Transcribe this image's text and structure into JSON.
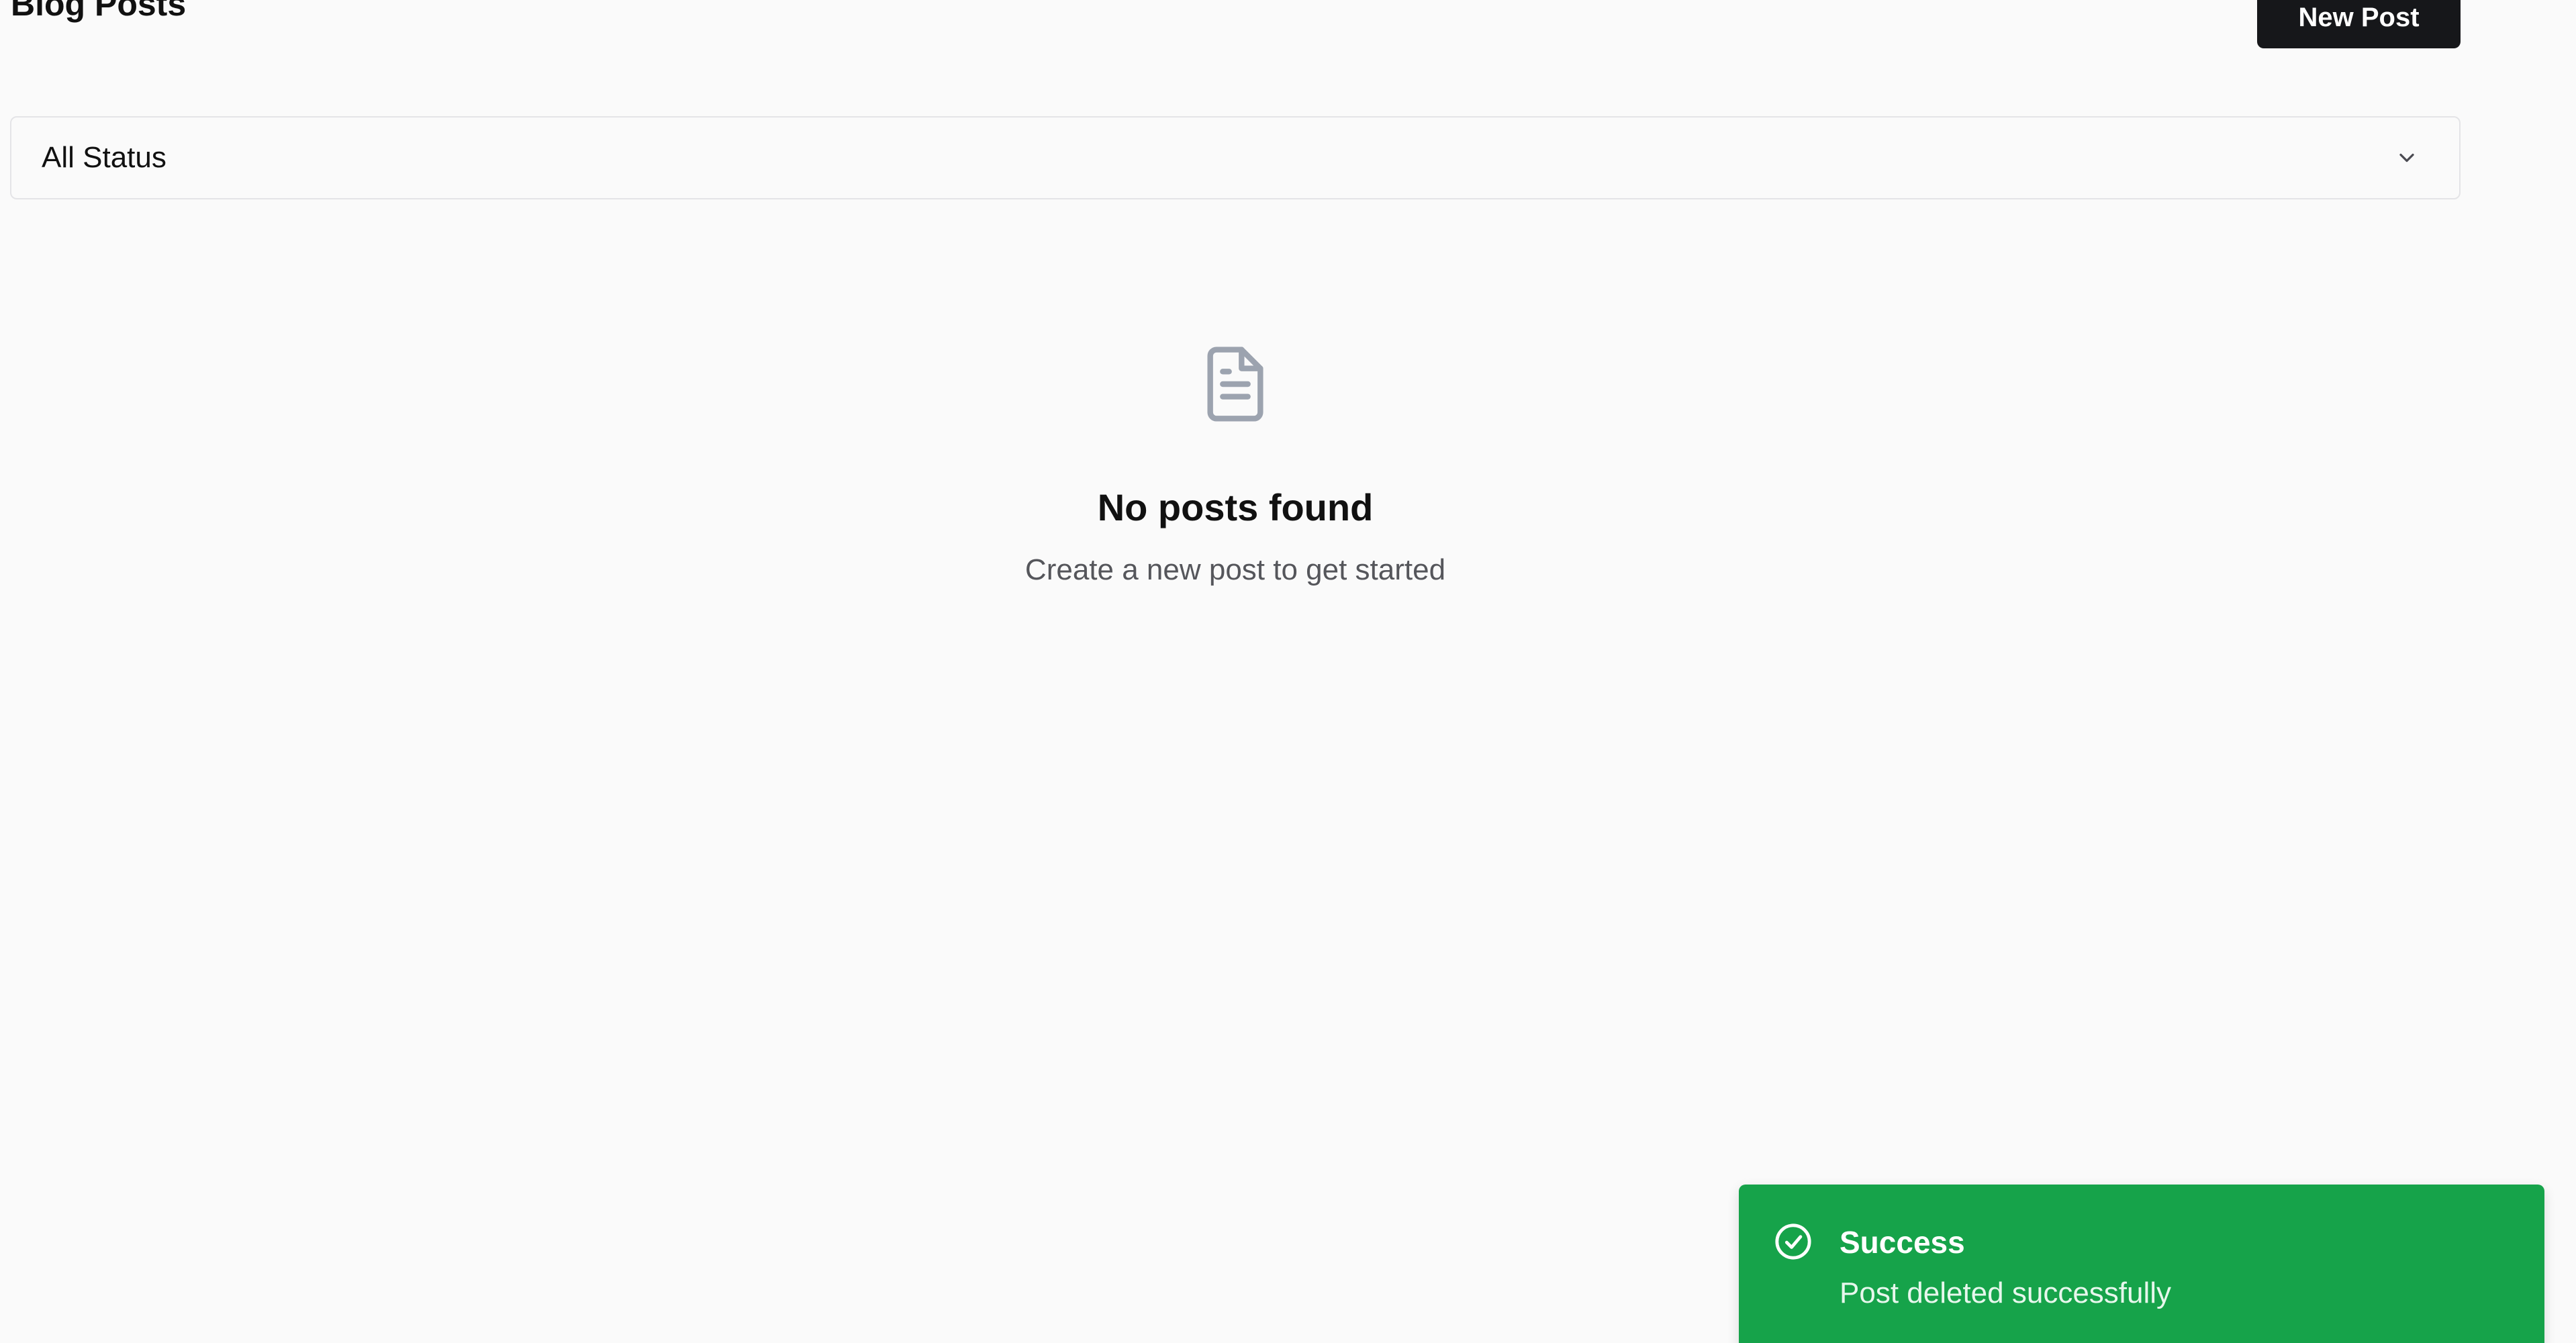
{
  "header": {
    "title": "Blog Posts",
    "new_post_label": "New Post"
  },
  "filter": {
    "selected": "All Status",
    "icon": "chevron-down-icon"
  },
  "empty_state": {
    "icon": "file-text-icon",
    "title": "No posts found",
    "subtitle": "Create a new post to get started"
  },
  "toast": {
    "icon": "check-circle-icon",
    "title": "Success",
    "message": "Post deleted successfully",
    "color": "#16a34a"
  },
  "colors": {
    "background": "#fafafa",
    "primary_button": "#16171a",
    "muted_text": "#55565b",
    "icon_gray": "#9ca3af",
    "border": "#e4e4e7"
  }
}
